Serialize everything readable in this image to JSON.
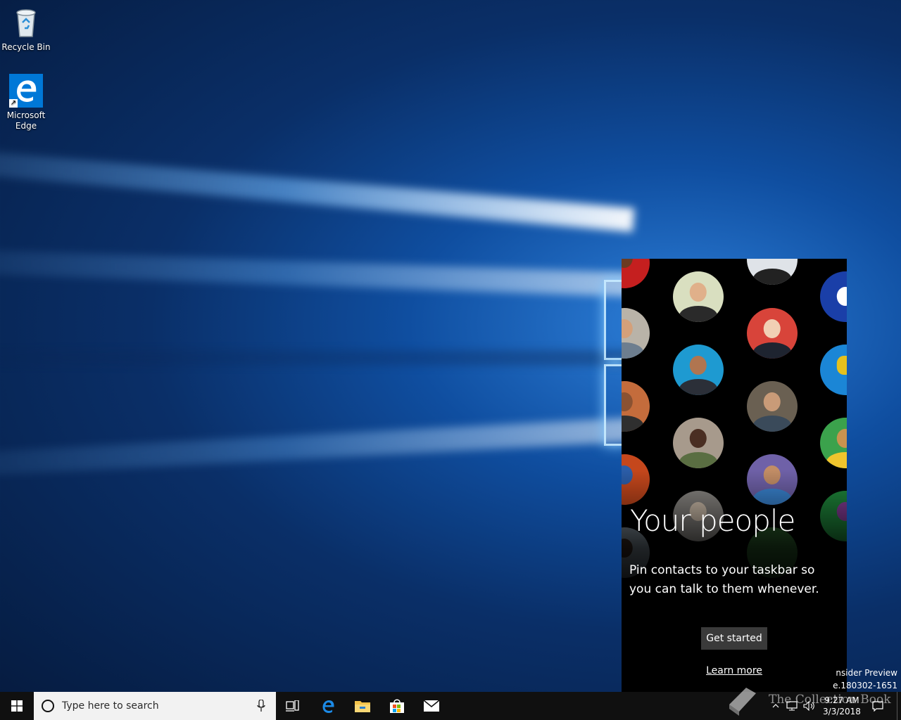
{
  "desktop": {
    "icons": [
      {
        "label": "Recycle Bin",
        "icon": "recycle-bin-icon"
      },
      {
        "label": "Microsoft Edge",
        "icon": "edge-icon"
      }
    ]
  },
  "people_flyout": {
    "title": "Your people",
    "description": "Pin contacts to your taskbar so you can talk to them whenever.",
    "get_started_label": "Get started",
    "learn_more_label": "Learn more"
  },
  "watermark": {
    "line1": "nsider Preview",
    "line2": "e.180302-1651",
    "overlay_text": "The Collection Book"
  },
  "taskbar": {
    "search_placeholder": "Type here to search",
    "pinned": [
      "task-view-icon",
      "edge-icon",
      "file-explorer-icon",
      "store-icon",
      "mail-icon"
    ],
    "clock": {
      "time": "9:27 AM",
      "date": "3/3/2018"
    }
  },
  "colors": {
    "taskbar": "#101010",
    "flyout_bg": "#000000",
    "accent": "#0078d7"
  }
}
